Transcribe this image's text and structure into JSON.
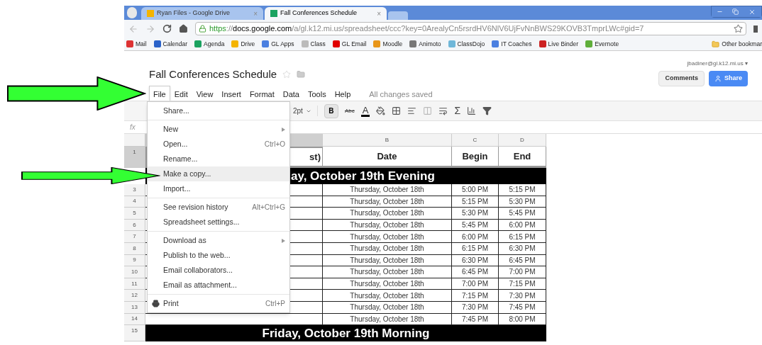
{
  "browser": {
    "tabs": [
      {
        "title": "Ryan Files - Google Drive",
        "selected": false,
        "close": "×"
      },
      {
        "title": "Fall Conferences Schedule",
        "selected": true,
        "close": "×"
      }
    ],
    "url": {
      "scheme": "https",
      "rest": "://",
      "host": "docs.google.com",
      "path": "/a/gl.k12.mi.us/spreadsheet/ccc?key=0ArealyCn5rsrdHV6NlV6UjFvNnBWS29KOVB3TmprLWc#gid=7"
    },
    "bookmarks": [
      {
        "label": "Mail",
        "color": "#dd3333"
      },
      {
        "label": "Calendar",
        "color": "#2a62c9"
      },
      {
        "label": "Agenda",
        "color": "#1aa260"
      },
      {
        "label": "Drive",
        "color": "#f4b400"
      },
      {
        "label": "GL Apps",
        "color": "#4a7fe0"
      },
      {
        "label": "Class",
        "color": "#bbbbbb"
      },
      {
        "label": "GL Email",
        "color": "#e00000"
      },
      {
        "label": "Moodle",
        "color": "#e8961a"
      },
      {
        "label": "Animoto",
        "color": "#777777"
      },
      {
        "label": "ClassDojo",
        "color": "#6fb7d9"
      },
      {
        "label": "IT Coaches",
        "color": "#4a7fe0"
      },
      {
        "label": "Live Binder",
        "color": "#cc2222"
      },
      {
        "label": "Evernote",
        "color": "#5fae3b"
      }
    ],
    "other_bookmarks": "Other bookmar"
  },
  "doc": {
    "title": "Fall Conferences Schedule",
    "starred": false,
    "user": "jbadiner@gl.k12.mi.us",
    "user_caret": "▾",
    "comments": "Comments",
    "share": "Share",
    "menus": [
      {
        "label": "File",
        "selected": true
      },
      {
        "label": "Edit",
        "selected": false
      },
      {
        "label": "View",
        "selected": false
      },
      {
        "label": "Insert",
        "selected": false
      },
      {
        "label": "Format",
        "selected": false
      },
      {
        "label": "Data",
        "selected": false
      },
      {
        "label": "Tools",
        "selected": false
      },
      {
        "label": "Help",
        "selected": false
      }
    ],
    "save_status": "All changes saved"
  },
  "toolbar": [
    {
      "kind": "dropdown",
      "label": "2pt"
    },
    {
      "kind": "bold",
      "label": "B"
    },
    {
      "kind": "strike",
      "label": "Abc"
    },
    {
      "kind": "textcolor",
      "label": "A"
    },
    {
      "kind": "fill"
    },
    {
      "kind": "borders"
    },
    {
      "kind": "align"
    },
    {
      "kind": "merge"
    },
    {
      "kind": "wrap"
    },
    {
      "kind": "sum",
      "label": "Σ"
    },
    {
      "kind": "chart"
    },
    {
      "kind": "filter"
    }
  ],
  "formula_label": "fx",
  "sheet": {
    "columns": [
      {
        "selected": true
      },
      {
        "letter": "B",
        "selected": false
      },
      {
        "letter": "C",
        "selected": false
      },
      {
        "letter": "D",
        "selected": false
      }
    ],
    "header_row": {
      "number": "1",
      "selected": true,
      "cells": [
        "st)",
        "Date",
        "Begin",
        "End"
      ]
    },
    "rows": [
      {
        "kind": "section",
        "covered": true,
        "text": "ay, October 19th Evening"
      },
      {
        "kind": "slot",
        "number": "3",
        "date": "Thursday, October 18th",
        "begin": "5:00 PM",
        "end": "5:15 PM"
      },
      {
        "kind": "slot",
        "number": "4",
        "date": "Thursday, October 18th",
        "begin": "5:15 PM",
        "end": "5:30 PM"
      },
      {
        "kind": "slot",
        "number": "5",
        "date": "Thursday, October 18th",
        "begin": "5:30 PM",
        "end": "5:45 PM"
      },
      {
        "kind": "slot",
        "number": "6",
        "date": "Thursday, October 18th",
        "begin": "5:45 PM",
        "end": "6:00 PM"
      },
      {
        "kind": "slot",
        "number": "7",
        "date": "Thursday, October 18th",
        "begin": "6:00 PM",
        "end": "6:15 PM"
      },
      {
        "kind": "slot",
        "number": "8",
        "date": "Thursday, October 18th",
        "begin": "6:15 PM",
        "end": "6:30 PM"
      },
      {
        "kind": "slot",
        "number": "9",
        "date": "Thursday, October 18th",
        "begin": "6:30 PM",
        "end": "6:45 PM"
      },
      {
        "kind": "slot",
        "number": "10",
        "date": "Thursday, October 18th",
        "begin": "6:45 PM",
        "end": "7:00 PM"
      },
      {
        "kind": "slot",
        "number": "11",
        "date": "Thursday, October 18th",
        "begin": "7:00 PM",
        "end": "7:15 PM"
      },
      {
        "kind": "slot",
        "number": "12",
        "date": "Thursday, October 18th",
        "begin": "7:15 PM",
        "end": "7:30 PM"
      },
      {
        "kind": "slot",
        "number": "13",
        "date": "Thursday, October 18th",
        "begin": "7:30 PM",
        "end": "7:45 PM"
      },
      {
        "kind": "slot",
        "number": "14",
        "date": "Thursday, October 18th",
        "begin": "7:45 PM",
        "end": "8:00 PM"
      },
      {
        "kind": "section",
        "number": "15",
        "covered": false,
        "text": "Friday, October 19th Morning"
      }
    ]
  },
  "file_menu": [
    [
      {
        "label": "Share...",
        "selected": false
      }
    ],
    [
      {
        "label": "New",
        "submenu": true,
        "selected": false
      },
      {
        "label": "Open...",
        "shortcut": "Ctrl+O",
        "selected": false
      },
      {
        "label": "Rename...",
        "selected": false
      },
      {
        "label": "Make a copy...",
        "selected": true
      },
      {
        "label": "Import...",
        "selected": false
      }
    ],
    [
      {
        "label": "See revision history",
        "shortcut": "Alt+Ctrl+G",
        "selected": false
      },
      {
        "label": "Spreadsheet settings...",
        "selected": false
      }
    ],
    [
      {
        "label": "Download as",
        "submenu": true,
        "selected": false
      },
      {
        "label": "Publish to the web...",
        "selected": false
      },
      {
        "label": "Email collaborators...",
        "selected": false
      },
      {
        "label": "Email as attachment...",
        "selected": false
      }
    ],
    [
      {
        "label": "Print",
        "shortcut": "Ctrl+P",
        "selected": false
      }
    ]
  ]
}
